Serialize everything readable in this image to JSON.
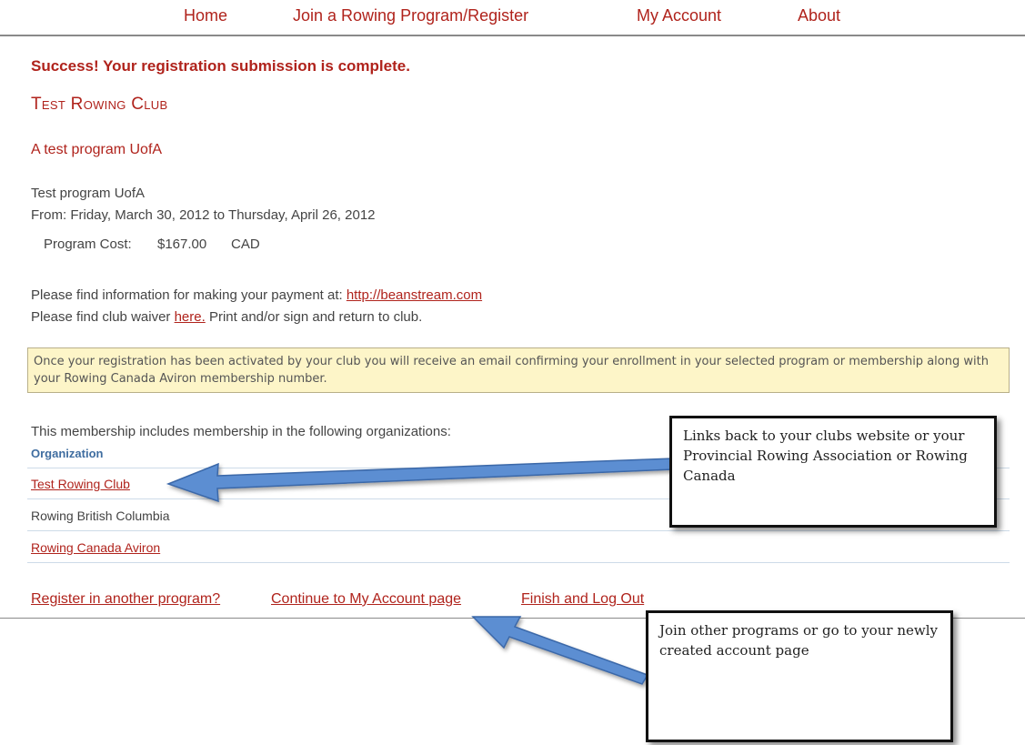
{
  "nav": {
    "home": "Home",
    "join": "Join a Rowing Program/Register",
    "account": "My Account",
    "about": "About"
  },
  "success_message": "Success! Your registration submission is complete.",
  "club_name": "Test Rowing Club",
  "program": {
    "heading": "A test program UofA",
    "name": "Test program UofA",
    "dates": "From: Friday, March 30, 2012 to Thursday, April 26, 2012",
    "cost_label": "Program Cost:",
    "cost_value": "$167.00",
    "currency": "CAD"
  },
  "payment": {
    "prefix": "Please find information for making your payment at: ",
    "link": "http://beanstream.com"
  },
  "waiver": {
    "prefix": "Please find club waiver ",
    "link": "here.",
    "suffix": " Print and/or sign and return to club."
  },
  "notice": "Once your registration has been activated by your club you will receive an email confirming your enrollment in your selected program or membership along with your Rowing Canada Aviron membership number.",
  "membership": {
    "intro": "This membership includes membership in the following organizations:",
    "column_header": "Organization",
    "organizations": [
      {
        "name": "Test Rowing Club",
        "is_link": true
      },
      {
        "name": "Rowing British Columbia",
        "is_link": false
      },
      {
        "name": "Rowing Canada Aviron",
        "is_link": true
      }
    ]
  },
  "actions": {
    "register_another": "Register in another program?",
    "continue_account": "Continue to My Account page",
    "finish_logout": "Finish and Log Out"
  },
  "callouts": {
    "links": "Links back to your clubs website or your Provincial Rowing Association or Rowing Canada",
    "join": "Join other programs or go to your newly created account page"
  },
  "colors": {
    "accent_red": "#b0231c",
    "notice_bg": "#fdf5c8",
    "table_header_blue": "#3f6da0",
    "arrow_blue": "#5b8ed2"
  }
}
